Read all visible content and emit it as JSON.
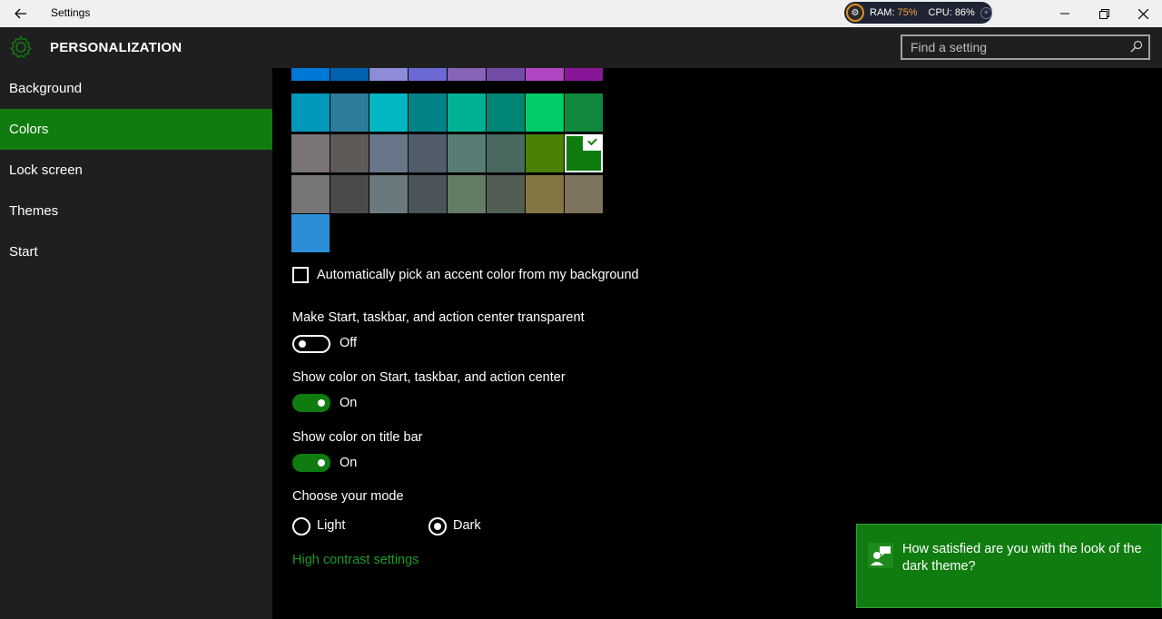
{
  "window": {
    "title": "Settings",
    "back_icon": "arrow-left-icon",
    "minimize_icon": "minimize-icon",
    "maximize_icon": "restore-icon",
    "close_icon": "close-icon"
  },
  "monitor": {
    "ram_label": "RAM:",
    "ram_value": "75%",
    "cpu_label": "CPU:",
    "cpu_value": "86%",
    "plus": "+"
  },
  "header": {
    "title": "PERSONALIZATION",
    "icon": "gear-icon"
  },
  "search": {
    "placeholder": "Find a setting",
    "value": ""
  },
  "sidebar": {
    "items": [
      {
        "label": "Background",
        "active": false
      },
      {
        "label": "Colors",
        "active": true
      },
      {
        "label": "Lock screen",
        "active": false
      },
      {
        "label": "Themes",
        "active": false
      },
      {
        "label": "Start",
        "active": false
      }
    ]
  },
  "accent_colors": {
    "rows": [
      [
        "#0078d7",
        "#0063b1",
        "#8e8cd8",
        "#6b69d6",
        "#8764b8",
        "#744da9",
        "#b146c2",
        "#881798"
      ],
      [
        "#0099bc",
        "#2d7d9a",
        "#00b7c3",
        "#038387",
        "#00b294",
        "#018574",
        "#00cc6a",
        "#10893e"
      ],
      [
        "#7a7574",
        "#5d5a58",
        "#68768a",
        "#515c6b",
        "#567c73",
        "#486860",
        "#498205",
        "#107c10"
      ],
      [
        "#767676",
        "#4c4a48",
        "#69797e",
        "#4a5459",
        "#647c64",
        "#525e54",
        "#847545",
        "#7e735f"
      ],
      [
        "#2b8fd8"
      ]
    ],
    "selected": "#107c10"
  },
  "auto_pick": {
    "label": "Automatically pick an accent color from my background",
    "checked": false
  },
  "transparency": {
    "label": "Make Start, taskbar, and action center transparent",
    "state": "Off"
  },
  "show_color_start": {
    "label": "Show color on Start, taskbar, and action center",
    "state": "On"
  },
  "show_color_title": {
    "label": "Show color on title bar",
    "state": "On"
  },
  "mode": {
    "label": "Choose your mode",
    "options": [
      "Light",
      "Dark"
    ],
    "selected": "Dark"
  },
  "high_contrast_link": "High contrast settings",
  "toast": {
    "text": "How satisfied are you with the look of the dark theme?",
    "icon": "feedback-icon"
  },
  "colors": {
    "accent": "#107c10",
    "sidebar_bg": "#1f1f1f",
    "link": "#1b9b2a"
  }
}
